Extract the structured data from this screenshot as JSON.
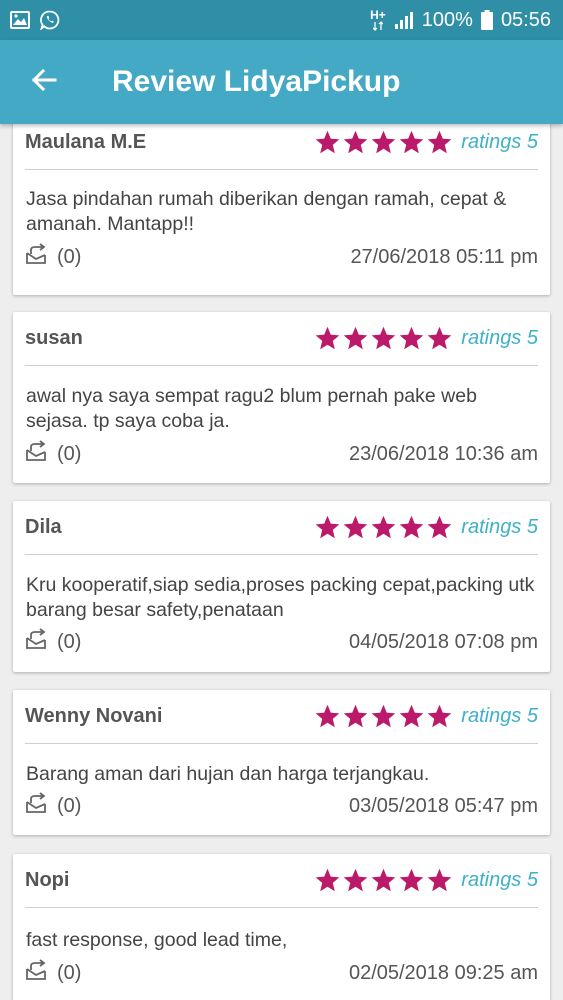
{
  "status_bar": {
    "icons": [
      "image-icon",
      "whatsapp-icon",
      "network-hplus-icon",
      "signal-icon",
      "battery-icon"
    ],
    "network_label": "H+",
    "battery": "100%",
    "time": "05:56"
  },
  "app_bar": {
    "back_icon": "arrow-left-icon",
    "title": "Review LidyaPickup"
  },
  "colors": {
    "status_bar": "#2f8fa6",
    "app_bar": "#43a9c4",
    "star": "#bb1a6a",
    "rating_label": "#3eb0c9"
  },
  "reviews": [
    {
      "name": "Maulana M.E",
      "stars": 5,
      "rating_label": "ratings 5",
      "text": "Jasa pindahan rumah diberikan dengan ramah, cepat & amanah. Mantapp!!",
      "reply_count": "(0)",
      "date": "27/06/2018 05:11 pm"
    },
    {
      "name": "susan",
      "stars": 5,
      "rating_label": "ratings 5",
      "text": "awal nya saya sempat ragu2 blum pernah pake web sejasa. tp saya coba ja.",
      "reply_count": "(0)",
      "date": "23/06/2018 10:36 am"
    },
    {
      "name": "Dila",
      "stars": 5,
      "rating_label": "ratings 5",
      "text": "Kru kooperatif,siap sedia,proses packing cepat,packing utk barang besar safety,penataan",
      "reply_count": "(0)",
      "date": "04/05/2018 07:08 pm"
    },
    {
      "name": "Wenny Novani",
      "stars": 5,
      "rating_label": "ratings 5",
      "text": "Barang aman dari hujan dan harga terjangkau.",
      "reply_count": "(0)",
      "date": "03/05/2018 05:47 pm"
    },
    {
      "name": "Nopi",
      "stars": 5,
      "rating_label": "ratings 5",
      "text": "fast response, good lead time,",
      "reply_count": "(0)",
      "date": "02/05/2018 09:25 am"
    }
  ]
}
